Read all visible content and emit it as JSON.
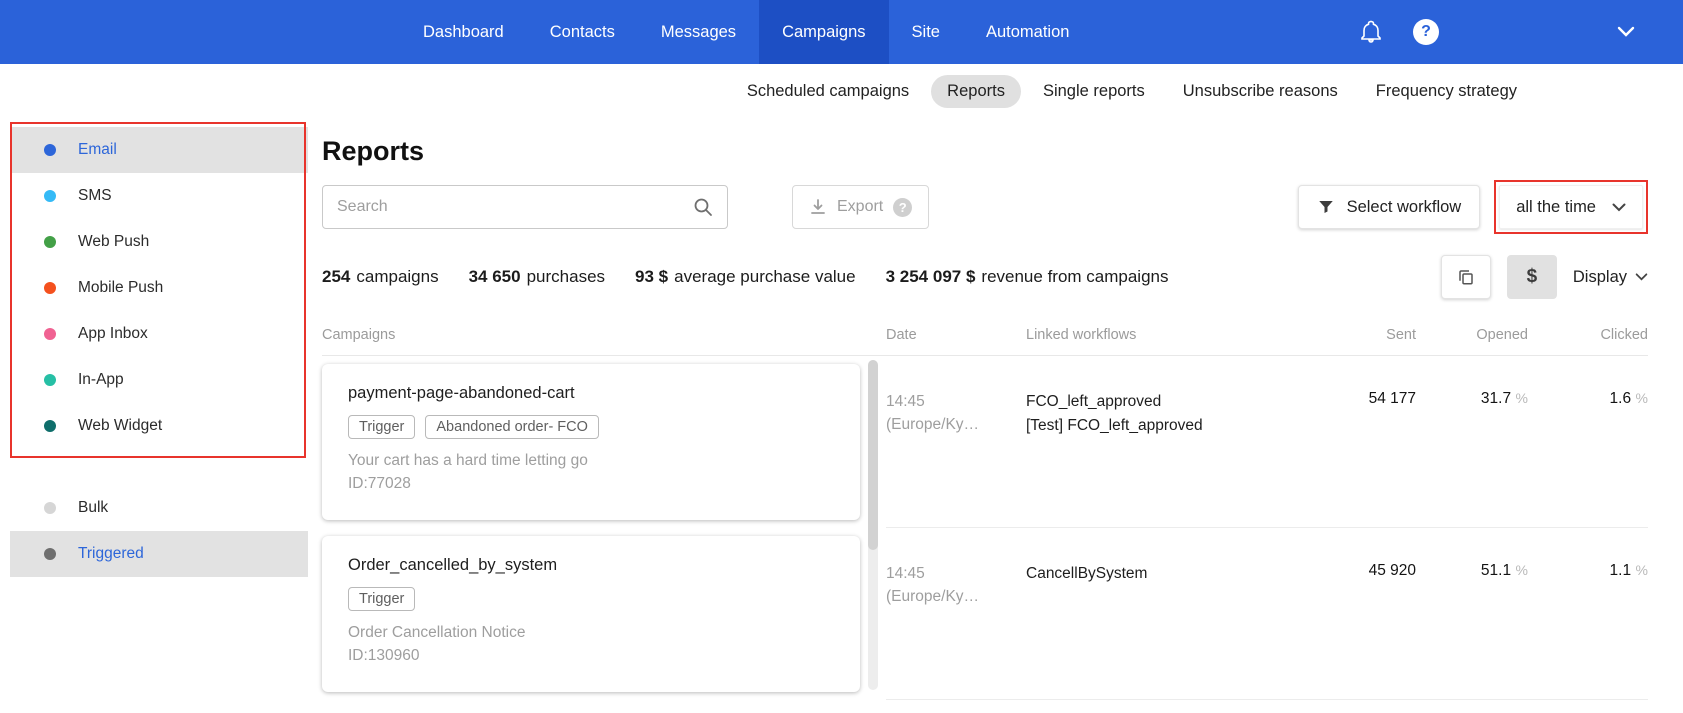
{
  "colors": {
    "topbar_blue": "#2b62d9",
    "active_tab_blue": "#1d4fc4",
    "selected_item_bg": "#e2e2e2",
    "selected_text_blue": "#2d66d9",
    "annotation_red": "#e8342c"
  },
  "topnav": {
    "items": [
      {
        "label": "Dashboard"
      },
      {
        "label": "Contacts"
      },
      {
        "label": "Messages"
      },
      {
        "label": "Campaigns"
      },
      {
        "label": "Site"
      },
      {
        "label": "Automation"
      }
    ],
    "help_glyph": "?"
  },
  "subnav": {
    "items": [
      {
        "label": "Scheduled campaigns"
      },
      {
        "label": "Reports"
      },
      {
        "label": "Single reports"
      },
      {
        "label": "Unsubscribe reasons"
      },
      {
        "label": "Frequency strategy"
      }
    ],
    "selected": "Reports"
  },
  "sidebar": {
    "channels": [
      {
        "label": "Email",
        "color": "#2d66d9"
      },
      {
        "label": "SMS",
        "color": "#35baf6"
      },
      {
        "label": "Web Push",
        "color": "#43a047"
      },
      {
        "label": "Mobile Push",
        "color": "#f4511e"
      },
      {
        "label": "App Inbox",
        "color": "#f06292"
      },
      {
        "label": "In-App",
        "color": "#26bfa5"
      },
      {
        "label": "Web Widget",
        "color": "#0f6e6b"
      }
    ],
    "types": [
      {
        "label": "Bulk",
        "color": "#d6d6d6"
      },
      {
        "label": "Triggered",
        "color": "#6f6f6f"
      }
    ]
  },
  "main": {
    "title": "Reports",
    "search_placeholder": "Search",
    "export_label": "Export",
    "export_help": "?",
    "select_workflow_label": "Select workflow",
    "time_filter": "all the time",
    "display_label": "Display",
    "currency_symbol": "$",
    "stats": [
      {
        "value": "254",
        "label": "campaigns"
      },
      {
        "value": "34 650",
        "label": "purchases"
      },
      {
        "value": "93 $",
        "label": "average purchase value"
      },
      {
        "value": "3 254 097 $",
        "label": "revenue from campaigns"
      }
    ],
    "table": {
      "columns": [
        "Campaigns",
        "Date",
        "Linked workflows",
        "Sent",
        "Opened",
        "Clicked"
      ],
      "rows": [
        {
          "name": "payment-page-abandoned-cart",
          "tags": [
            "Trigger",
            "Abandoned order- FCO"
          ],
          "subject": "Your cart has a hard time letting go",
          "id": "ID:77028",
          "date_time": "14:45",
          "date_tz": "(Europe/Ky…",
          "workflows": [
            "FCO_left_approved",
            "[Test] FCO_left_approved"
          ],
          "sent": "54 177",
          "opened": "31.7",
          "opened_unit": "%",
          "clicked": "1.6",
          "clicked_unit": "%"
        },
        {
          "name": "Order_cancelled_by_system",
          "tags": [
            "Trigger"
          ],
          "subject": "Order Cancellation Notice",
          "id": "ID:130960",
          "date_time": "14:45",
          "date_tz": "(Europe/Ky…",
          "workflows": [
            "CancellBySystem"
          ],
          "sent": "45 920",
          "opened": "51.1",
          "opened_unit": "%",
          "clicked": "1.1",
          "clicked_unit": "%"
        }
      ]
    }
  }
}
